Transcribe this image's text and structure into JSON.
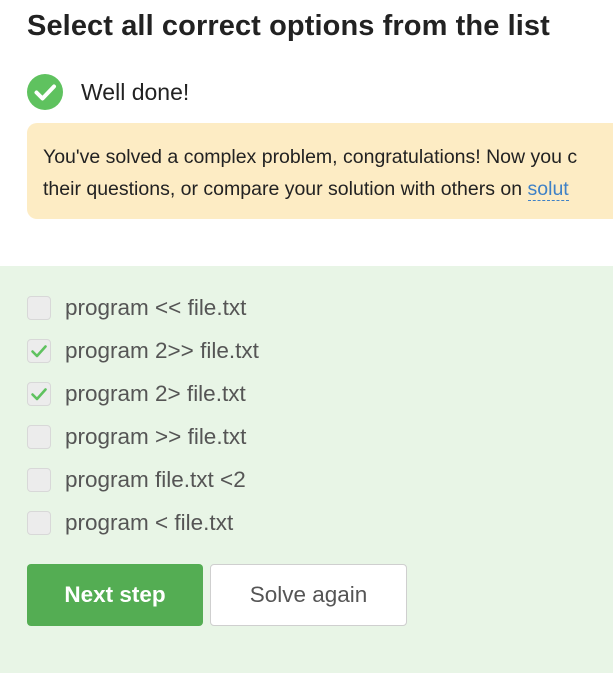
{
  "quiz": {
    "title": "Select all correct options from the list",
    "feedback": {
      "status_icon": "checkmark-circle-icon",
      "status_color": "#5fc25f",
      "message": "Well done!"
    },
    "notice": {
      "line1": "You've solved a complex problem, congratulations! Now you c",
      "line2_prefix": "their questions, or compare your solution with others on ",
      "link_text": "solut",
      "background_color": "#fdecc4"
    },
    "options": [
      {
        "label": "program << file.txt",
        "checked": false
      },
      {
        "label": "program 2>> file.txt",
        "checked": true
      },
      {
        "label": "program 2> file.txt",
        "checked": true
      },
      {
        "label": "program >> file.txt",
        "checked": false
      },
      {
        "label": "program file.txt <2",
        "checked": false
      },
      {
        "label": "program < file.txt",
        "checked": false
      }
    ],
    "buttons": {
      "next_step": "Next step",
      "solve_again": "Solve again"
    },
    "colors": {
      "accent_green": "#54ad53",
      "answer_area_bg": "#e8f5e6"
    }
  }
}
